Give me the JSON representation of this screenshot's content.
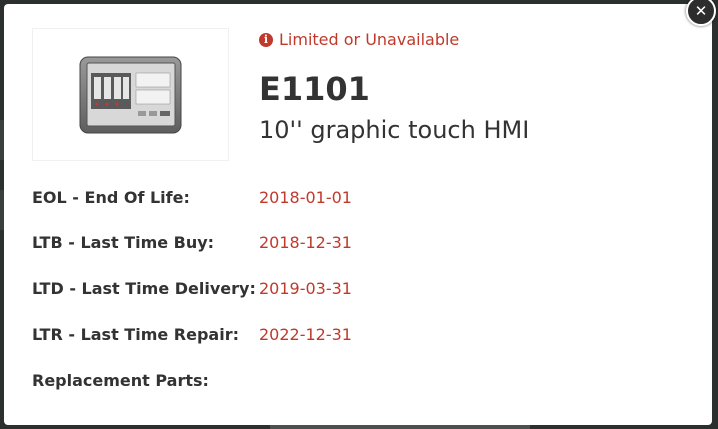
{
  "status": {
    "icon": "info-circle-icon",
    "text": "Limited or Unavailable",
    "color": "#c0392b"
  },
  "product": {
    "code": "E1101",
    "description": "10'' graphic touch HMI"
  },
  "details": [
    {
      "label": "EOL - End Of Life:",
      "value": "2018-01-01"
    },
    {
      "label": "LTB - Last Time Buy:",
      "value": "2018-12-31"
    },
    {
      "label": "LTD - Last Time Delivery:",
      "value": "2019-03-31"
    },
    {
      "label": "LTR - Last Time Repair:",
      "value": "2022-12-31"
    },
    {
      "label": "Replacement Parts:",
      "value": ""
    }
  ],
  "close_icon": "close-icon"
}
